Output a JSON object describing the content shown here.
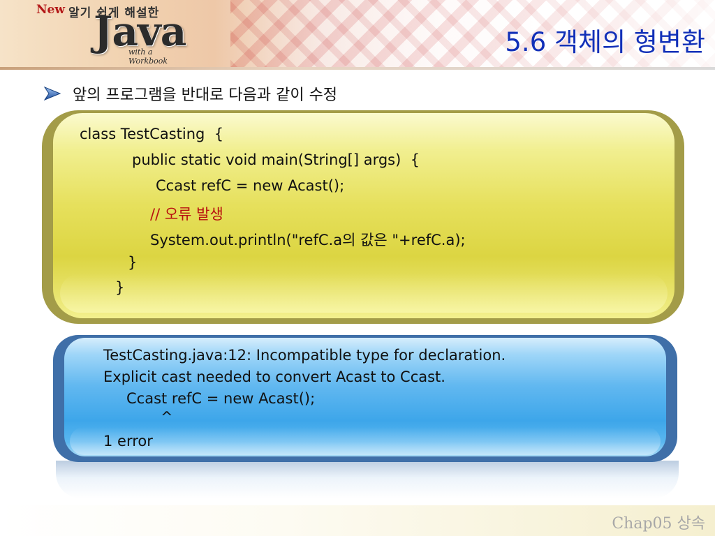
{
  "header": {
    "logo_new": "New",
    "logo_subtitle": "알기 쉽게 해설한",
    "logo_main": "Java",
    "logo_tagline": "with a Workbook",
    "title": "5.6 객체의 형변환"
  },
  "bullet": {
    "text": "앞의 프로그램을 반대로 다음과 같이 수정"
  },
  "code_box": {
    "lines": [
      "class TestCasting  {",
      "public static void main(String[] args)  {",
      "Ccast refC = new Acast();",
      "// 오류 발생",
      "System.out.println(\"refC.a의 값은 \"+refC.a);",
      "}",
      "}"
    ],
    "comment_color": "#b80f0f"
  },
  "error_box": {
    "lines": [
      "TestCasting.java:12: Incompatible type for declaration.",
      "Explicit cast needed to convert Acast to Ccast.",
      "Ccast refC = new Acast();",
      "^",
      "1 error"
    ]
  },
  "footer": {
    "text": "Chap05 상속"
  },
  "colors": {
    "title": "#1230b8",
    "code_box_fill": "#e6e05c",
    "code_box_border": "#a39c48",
    "error_box_fill": "#3da6ea",
    "error_box_border": "#3f6fa8",
    "bullet_arrow": "#1f4fa0"
  },
  "icons": {
    "bullet": "chevron-right-icon"
  }
}
